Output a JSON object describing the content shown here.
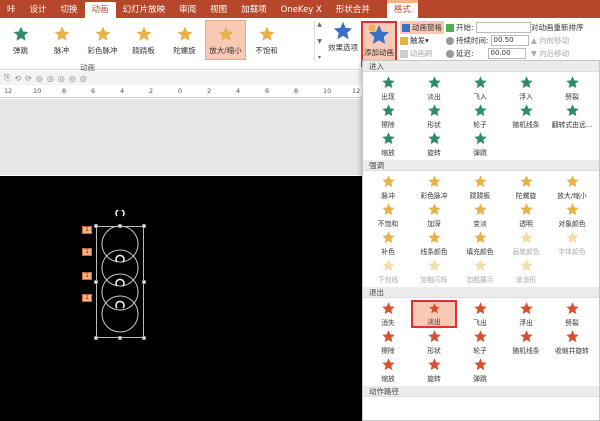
{
  "tabs": [
    {
      "label": "咔",
      "active": false
    },
    {
      "label": "设计",
      "active": false
    },
    {
      "label": "切换",
      "active": false
    },
    {
      "label": "动画",
      "active": true
    },
    {
      "label": "幻灯片放映",
      "active": false
    },
    {
      "label": "审阅",
      "active": false
    },
    {
      "label": "视图",
      "active": false
    },
    {
      "label": "加载项",
      "active": false
    },
    {
      "label": "OneKey X",
      "active": false
    },
    {
      "label": "形状合并",
      "active": false
    }
  ],
  "format_tab": "格式",
  "ribbon": {
    "gallery": [
      {
        "label": "弹跳",
        "color": "#2e8b6e"
      },
      {
        "label": "脉冲",
        "color": "#e8b24a"
      },
      {
        "label": "彩色脉冲",
        "color": "#e8b24a"
      },
      {
        "label": "跷跷板",
        "color": "#e8b24a"
      },
      {
        "label": "陀螺旋",
        "color": "#e8b24a"
      },
      {
        "label": "放大/缩小",
        "color": "#e8b24a"
      },
      {
        "label": "不饱和",
        "color": "#e8b24a"
      }
    ],
    "effect_options": "效果选项",
    "add_animation": "添加动画",
    "animation_pane": "动画窗格",
    "trigger": "触发",
    "animation_painter": "动画刷",
    "start_label": "开始:",
    "duration_label": "持续时间:",
    "duration_value": "00.50",
    "delay_label": "延迟:",
    "delay_value": "00.00",
    "reorder_title": "对动画重新排序",
    "move_earlier": "向前移动",
    "move_later": "向后移动",
    "group_label": "动画"
  },
  "ruler": [
    "12",
    "10",
    "8",
    "6",
    "4",
    "2",
    "0",
    "2",
    "4",
    "6",
    "8",
    "10",
    "12"
  ],
  "badges": [
    "1",
    "1",
    "1",
    "1"
  ],
  "panel": {
    "sections": [
      {
        "title": "进入",
        "items": [
          {
            "label": "出现",
            "color": "#2e8b6e",
            "dim": false
          },
          {
            "label": "淡出",
            "color": "#2e8b6e",
            "dim": false
          },
          {
            "label": "飞入",
            "color": "#2e8b6e",
            "dim": false
          },
          {
            "label": "浮入",
            "color": "#2e8b6e",
            "dim": false
          },
          {
            "label": "劈裂",
            "color": "#2e8b6e",
            "dim": false
          },
          {
            "label": "擦除",
            "color": "#2e8b6e",
            "dim": false
          },
          {
            "label": "形状",
            "color": "#2e8b6e",
            "dim": false
          },
          {
            "label": "轮子",
            "color": "#2e8b6e",
            "dim": false
          },
          {
            "label": "随机线条",
            "color": "#2e8b6e",
            "dim": false
          },
          {
            "label": "翻转式由远...",
            "color": "#2e8b6e",
            "dim": false
          },
          {
            "label": "缩放",
            "color": "#2e8b6e",
            "dim": false
          },
          {
            "label": "旋转",
            "color": "#2e8b6e",
            "dim": false
          },
          {
            "label": "弹跳",
            "color": "#2e8b6e",
            "dim": false
          }
        ]
      },
      {
        "title": "强调",
        "items": [
          {
            "label": "脉冲",
            "color": "#e8b24a",
            "dim": false
          },
          {
            "label": "彩色脉冲",
            "color": "#e8b24a",
            "dim": false
          },
          {
            "label": "跷跷板",
            "color": "#e8b24a",
            "dim": false
          },
          {
            "label": "陀螺旋",
            "color": "#e8b24a",
            "dim": false
          },
          {
            "label": "放大/缩小",
            "color": "#e8b24a",
            "dim": false
          },
          {
            "label": "不饱和",
            "color": "#e8b24a",
            "dim": false
          },
          {
            "label": "加深",
            "color": "#e8b24a",
            "dim": false
          },
          {
            "label": "变淡",
            "color": "#e8b24a",
            "dim": false
          },
          {
            "label": "透明",
            "color": "#e8b24a",
            "dim": false
          },
          {
            "label": "对象颜色",
            "color": "#e8b24a",
            "dim": false
          },
          {
            "label": "补色",
            "color": "#e8b24a",
            "dim": false
          },
          {
            "label": "线条颜色",
            "color": "#e8b24a",
            "dim": false
          },
          {
            "label": "填充颜色",
            "color": "#e8b24a",
            "dim": false
          },
          {
            "label": "画笔颜色",
            "color": "#e8b24a",
            "dim": true
          },
          {
            "label": "字体颜色",
            "color": "#e8b24a",
            "dim": true
          },
          {
            "label": "下划线",
            "color": "#e8b24a",
            "dim": true
          },
          {
            "label": "加粗闪烁",
            "color": "#e8b24a",
            "dim": true
          },
          {
            "label": "加粗展示",
            "color": "#e8b24a",
            "dim": true
          },
          {
            "label": "波浪形",
            "color": "#e8b24a",
            "dim": true
          }
        ]
      },
      {
        "title": "退出",
        "items": [
          {
            "label": "消失",
            "color": "#d9502f",
            "dim": false
          },
          {
            "label": "淡出",
            "color": "#d9502f",
            "dim": false,
            "highlight": true
          },
          {
            "label": "飞出",
            "color": "#d9502f",
            "dim": false
          },
          {
            "label": "浮出",
            "color": "#d9502f",
            "dim": false
          },
          {
            "label": "劈裂",
            "color": "#d9502f",
            "dim": false
          },
          {
            "label": "擦除",
            "color": "#d9502f",
            "dim": false
          },
          {
            "label": "形状",
            "color": "#d9502f",
            "dim": false
          },
          {
            "label": "轮子",
            "color": "#d9502f",
            "dim": false
          },
          {
            "label": "随机线条",
            "color": "#d9502f",
            "dim": false
          },
          {
            "label": "收缩并旋转",
            "color": "#d9502f",
            "dim": false
          },
          {
            "label": "缩放",
            "color": "#d9502f",
            "dim": false
          },
          {
            "label": "旋转",
            "color": "#d9502f",
            "dim": false
          },
          {
            "label": "弹跳",
            "color": "#d9502f",
            "dim": false
          }
        ]
      }
    ],
    "next_section": "动作路径"
  }
}
